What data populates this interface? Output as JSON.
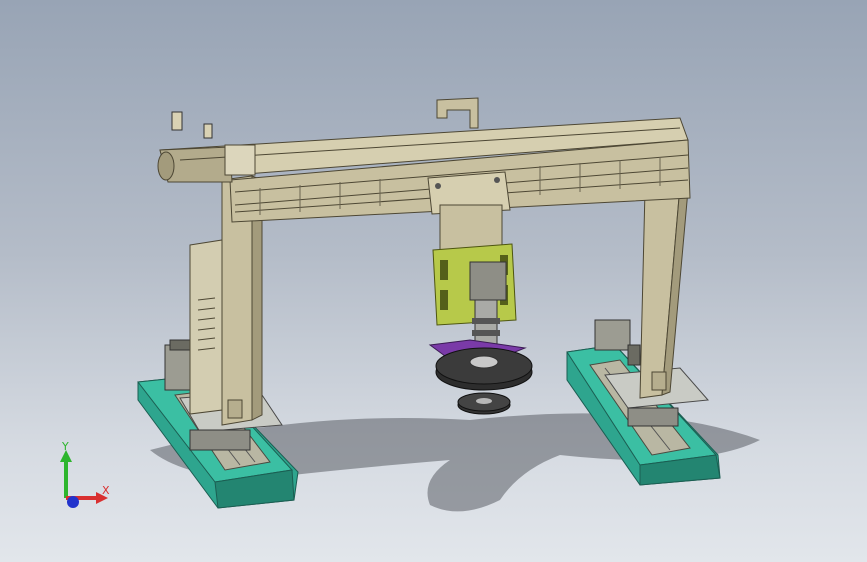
{
  "view": {
    "background_top": "#98a4b5",
    "background_bottom": "#e2e6eb"
  },
  "model": {
    "frame_color": "#c8c0a0",
    "base_color": "#2ea58e",
    "plate_color": "#e3e6c2",
    "purple_color": "#7a3aa8",
    "green_color": "#b7c94a"
  },
  "triad": {
    "y_label": "Y",
    "x_label": "X",
    "y_color": "#2db52d",
    "x_color": "#d93030",
    "z_color": "#2233cc"
  }
}
